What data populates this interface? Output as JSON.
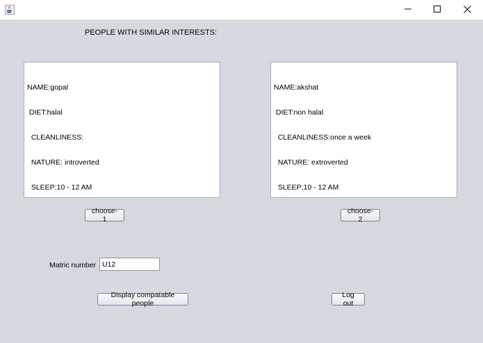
{
  "window": {
    "icons": {
      "app": "java-cup-icon",
      "minimize": "minimize-icon",
      "maximize": "maximize-icon",
      "close": "close-icon"
    }
  },
  "heading": "PEOPLE WITH SIMILAR INTERESTS:",
  "people": [
    {
      "name": "NAME:gopal",
      "diet": " DIET:halal",
      "cleanliness": "  CLEANLINESS:",
      "nature": "  NATURE: introverted",
      "sleep": "  SLEEP:10 - 12 AM"
    },
    {
      "name": "NAME:akshat",
      "diet": " DIET:non halal",
      "cleanliness": "  CLEANLINESS:once a week",
      "nature": "  NATURE: extroverted",
      "sleep": "  SLEEP:10 - 12 AM"
    }
  ],
  "buttons": {
    "choose1": "choose-1",
    "choose2": "choose-2",
    "display": "Display compatable people",
    "logout": "Log out"
  },
  "matric": {
    "label": "Matric number",
    "value": "U12"
  }
}
